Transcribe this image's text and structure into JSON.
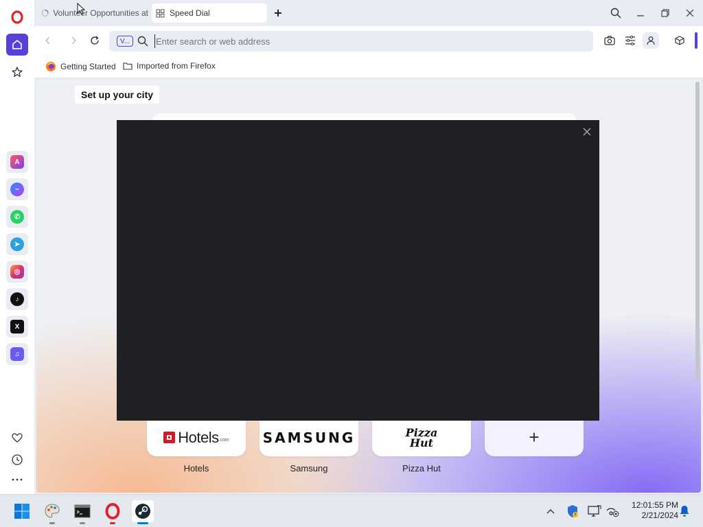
{
  "browser": {
    "logo": "opera-logo-icon",
    "accent": "#5b3fd9"
  },
  "tabs": [
    {
      "title": "Volunteer Opportunities at",
      "state": "loading",
      "active": false
    },
    {
      "title": "Speed Dial",
      "icon": "grid-icon",
      "active": true
    }
  ],
  "address_bar": {
    "placeholder": "Enter search or web address",
    "value": "",
    "vpn_badge": "V..."
  },
  "bookmarks": [
    {
      "label": "Getting Started",
      "icon": "firefox-icon"
    },
    {
      "label": "Imported from Firefox",
      "icon": "folder-icon"
    }
  ],
  "sidebar": {
    "apps": [
      "aria-icon",
      "messenger-icon",
      "whatsapp-icon",
      "telegram-icon",
      "instagram-icon",
      "tiktok-icon",
      "x-icon",
      "music-icon"
    ]
  },
  "speed_dial": {
    "city_prompt": "Set up your city",
    "tiles": [
      {
        "label": "Hotels",
        "logo_text": "Hotels",
        "logo_suffix": ".com"
      },
      {
        "label": "Samsung",
        "logo_text": "SAMSUNG"
      },
      {
        "label": "Pizza Hut",
        "logo_text": "Pizza Hut"
      },
      {
        "label": "",
        "logo_text": "+"
      }
    ]
  },
  "modal": {
    "background": "#1f2023"
  },
  "taskbar": {
    "time": "12:01:55 PM",
    "date": "2/21/2024"
  }
}
